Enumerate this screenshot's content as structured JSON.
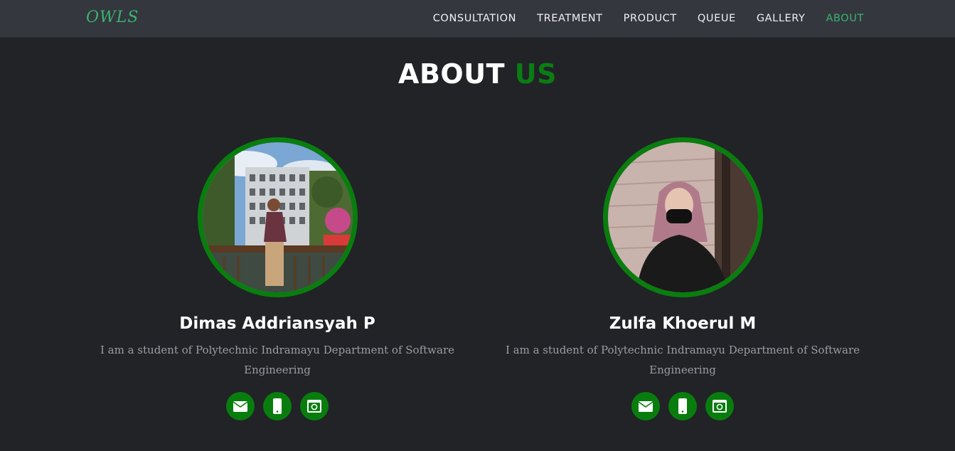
{
  "brand": "OWLS",
  "nav": {
    "items": [
      "CONSULTATION",
      "TREATMENT",
      "PRODUCT",
      "QUEUE",
      "GALLERY",
      "ABOUT"
    ],
    "active": "ABOUT"
  },
  "heading": {
    "main": "ABOUT",
    "accent": "US"
  },
  "members": [
    {
      "name": "Dimas Addriansyah P",
      "description": "I am a student of Polytechnic Indramayu Department of Software Engineering",
      "icons": [
        "envelope-icon",
        "phone-icon",
        "instagram-icon"
      ]
    },
    {
      "name": "Zulfa Khoerul M",
      "description": "I am a student of Polytechnic Indramayu Department of Software Engineering",
      "icons": [
        "envelope-icon",
        "phone-icon",
        "instagram-icon"
      ]
    }
  ],
  "colors": {
    "background": "#212327",
    "navbar": "#34373e",
    "accent_green": "#0a7d12",
    "nav_active": "#3cb371",
    "muted_text": "#9a9da3"
  }
}
